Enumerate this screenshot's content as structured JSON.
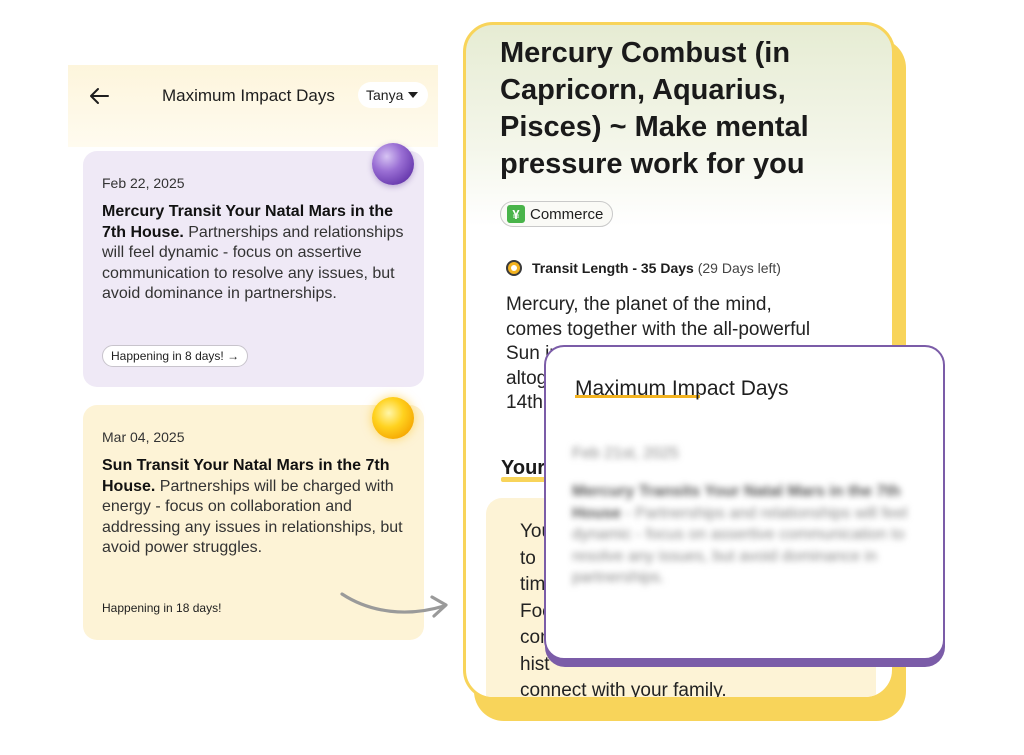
{
  "left_app": {
    "header": {
      "title": "Maximum Impact Days",
      "profile": "Tanya"
    },
    "cards": [
      {
        "date": "Feb 22, 2025",
        "title": "Mercury Transit Your Natal Mars in the 7th House.",
        "body": "Partnerships and relationships will feel dynamic - focus on assertive communication to resolve any issues, but avoid dominance in partnerships.",
        "cta": "Happening in 8 days! →",
        "planet": "mercury-planet-icon"
      },
      {
        "date": "Mar 04, 2025",
        "title": "Sun Transit Your Natal Mars in the 7th House.",
        "body": "Partnerships will be charged with energy - focus on collaboration and addressing any issues in relationships, but avoid power struggles.",
        "cta": "Happening in 18 days!",
        "planet": "sun-planet-icon"
      }
    ]
  },
  "right_app": {
    "title": "Mercury Combust (in Capricorn, Aquarius, Pisces) ~ Make mental pressure work for you",
    "tag": {
      "icon": "¥",
      "label": "Commerce"
    },
    "transit": {
      "label": "Transit Length - 35 Days",
      "remaining": "(29 Days left)"
    },
    "description_lines": [
      "Mercury, the planet of the mind,",
      "comes together with the all-powerful",
      "Sun in",
      "altog",
      "14th"
    ],
    "section_heading": "Your",
    "box_lines": [
      "You",
      "to",
      "tim",
      "Foc",
      "con",
      "hist",
      "connect with your family."
    ]
  },
  "popup": {
    "title": "Maximum Impact Days",
    "date": "Feb 21st, 2025",
    "body_title": "Mercury Transits Your Natal Mars in the 7th House",
    "body": "- Partnerships and relationships will feel dynamic - focus on assertive communication to resolve any issues, but avoid dominance in partnerships."
  },
  "colors": {
    "accent_yellow": "#f8d45a",
    "popup_border": "#7b5ca8",
    "card_purple": "#efe9f6",
    "card_yellow": "#fdf3d6"
  }
}
